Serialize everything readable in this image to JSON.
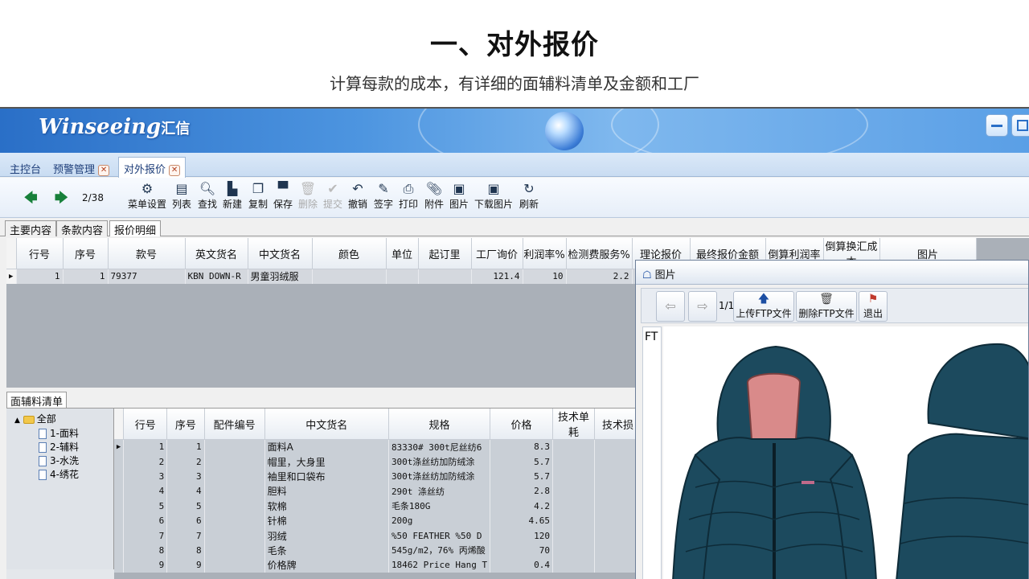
{
  "slide": {
    "title": "一、对外报价",
    "subtitle": "计算每款的成本，有详细的面辅料清单及金额和工厂"
  },
  "app": {
    "logo_text": "Winseeing",
    "logo_cn": "汇信",
    "tabs": [
      {
        "label": "主控台",
        "closable": false
      },
      {
        "label": "预警管理",
        "closable": true
      },
      {
        "label": "对外报价",
        "closable": true,
        "active": true
      }
    ],
    "toolbar": {
      "pager": "2/38",
      "buttons": [
        {
          "label": "菜单设置",
          "icon": "gear-icon",
          "glyph": "⚙"
        },
        {
          "label": "列表",
          "icon": "list-icon",
          "glyph": "▤"
        },
        {
          "label": "查找",
          "icon": "search-icon",
          "glyph": "🔍︎"
        },
        {
          "label": "新建",
          "icon": "new-icon",
          "glyph": "▙"
        },
        {
          "label": "复制",
          "icon": "copy-icon",
          "glyph": "❐"
        },
        {
          "label": "保存",
          "icon": "save-icon",
          "glyph": "▀"
        },
        {
          "label": "删除",
          "icon": "trash-icon",
          "glyph": "🗑︎",
          "disabled": true
        },
        {
          "label": "提交",
          "icon": "submit-icon",
          "glyph": "✔",
          "disabled": true
        },
        {
          "label": "撤销",
          "icon": "undo-icon",
          "glyph": "↶"
        },
        {
          "label": "签字",
          "icon": "sign-icon",
          "glyph": "✎"
        },
        {
          "label": "打印",
          "icon": "print-icon",
          "glyph": "⎙"
        },
        {
          "label": "附件",
          "icon": "attach-icon",
          "glyph": "📎︎"
        },
        {
          "label": "图片",
          "icon": "image-icon",
          "glyph": "▣"
        },
        {
          "label": "下载图片",
          "icon": "download-image-icon",
          "glyph": "▣"
        },
        {
          "label": "刷新",
          "icon": "refresh-icon",
          "glyph": "↻"
        }
      ]
    },
    "subtabs": [
      "主要内容",
      "条款内容",
      "报价明细"
    ],
    "main_grid": {
      "headers": [
        "行号",
        "序号",
        "款号",
        "英文货名",
        "中文货名",
        "颜色",
        "单位",
        "起订里",
        "工厂询价",
        "利润率%",
        "检测费服务%",
        "理论报价",
        "最终报价金额",
        "倒算利润率",
        "倒算换汇成本",
        "图片"
      ],
      "rows": [
        [
          "1",
          "1",
          "79377",
          "KBN DOWN-R",
          "男童羽绒服",
          "",
          "",
          "",
          "121.4",
          "10",
          "2.2",
          "",
          "",
          "",
          "",
          ""
        ]
      ]
    },
    "bom": {
      "label": "面辅料清单",
      "tree": {
        "root": "全部",
        "items": [
          "1-面料",
          "2-辅料",
          "3-水洗",
          "4-绣花"
        ]
      },
      "headers": [
        "行号",
        "序号",
        "配件编号",
        "中文货名",
        "规格",
        "价格",
        "技术单耗",
        "技术损"
      ],
      "rows": [
        [
          "1",
          "1",
          "",
          "面料A",
          "83330# 300t尼丝纺6",
          "8.3"
        ],
        [
          "2",
          "2",
          "",
          "帽里，大身里",
          "300t涤丝纺加防绒涂",
          "5.7"
        ],
        [
          "3",
          "3",
          "",
          "袖里和口袋布",
          "300t涤丝纺加防绒涂",
          "5.7"
        ],
        [
          "4",
          "4",
          "",
          "胆料",
          "290t 涤丝纺",
          "2.8"
        ],
        [
          "5",
          "5",
          "",
          "软棉",
          "毛条180G",
          "4.2"
        ],
        [
          "6",
          "6",
          "",
          "针棉",
          "200g",
          "4.65"
        ],
        [
          "7",
          "7",
          "",
          "羽绒",
          " %50 FEATHER %50 D",
          "120"
        ],
        [
          "8",
          "8",
          "",
          "毛条",
          "545g/m2，76% 丙烯酸",
          "70"
        ],
        [
          "9",
          "9",
          "",
          "价格牌",
          "18462 Price Hang T",
          "0.4"
        ]
      ]
    },
    "popup": {
      "title": "图片",
      "page": "1/1",
      "upload_label": "上传FTP文件",
      "delete_label": "删除FTP文件",
      "exit_label": "退出",
      "side_text": "FT"
    }
  }
}
